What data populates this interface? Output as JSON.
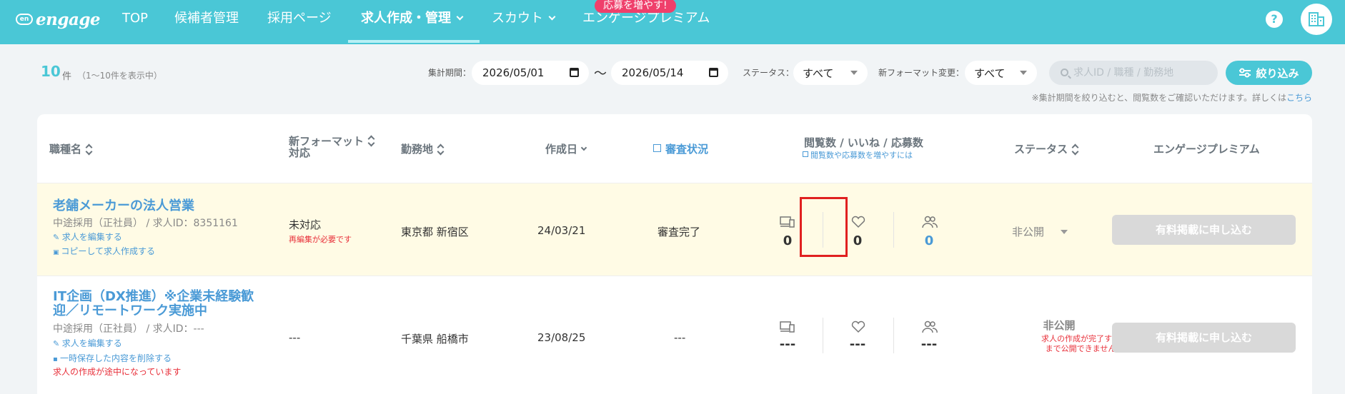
{
  "nav": {
    "logo_mark": "en",
    "logo_text": "engage",
    "items": [
      "TOP",
      "候補者管理",
      "採用ページ",
      "求人作成・管理",
      "スカウト",
      "エンゲージプレミアム"
    ],
    "promo_badge": "応募を増やす!"
  },
  "toolbar": {
    "count": "10",
    "count_unit": "件",
    "count_note": "（1〜10件を表示中）",
    "period_label": "集計期間：",
    "date_from": "2026/05/01",
    "date_sep": "〜",
    "date_to": "2026/05/14",
    "status_label": "ステータス：",
    "status_value": "すべて",
    "format_label": "新フォーマット変更：",
    "format_value": "すべて",
    "search_placeholder": "求人ID / 職種 / 勤務地",
    "filter_button": "絞り込み",
    "note": "※集計期間を絞り込むと、閲覧数をご確認いただけます。詳しくは",
    "note_link": "こちら"
  },
  "table": {
    "headers": {
      "job": "職種名",
      "format_line1": "新フォーマット",
      "format_line2": "対応",
      "location": "勤務地",
      "created": "作成日",
      "review": "審査状況",
      "stats": "閲覧数 / いいね / 応募数",
      "stats_sub": "閲覧数や応募数を増やすには",
      "status": "ステータス",
      "premium": "エンゲージプレミアム"
    },
    "rows": [
      {
        "title": "老舗メーカーの法人営業",
        "meta": "中途採用（正社員） / 求人ID：8351161",
        "link1": "求人を編集する",
        "link2": "コピーして求人作成する",
        "format": "未対応",
        "format_note": "再編集が必要です",
        "location": "東京都 新宿区",
        "created": "24/03/21",
        "review": "審査完了",
        "views": "0",
        "likes": "0",
        "applies": "0",
        "status": "非公開",
        "premium_button": "有料掲載に申し込む"
      },
      {
        "title_line1": "IT企画（DX推進）※企業未経験歓",
        "title_line2": "迎／リモートワーク実施中",
        "meta": "中途採用（正社員） / 求人ID：---",
        "link1": "求人を編集する",
        "link2": "一時保存した内容を削除する",
        "warning": "求人の作成が途中になっています",
        "format": "---",
        "location": "千葉県 船橋市",
        "created": "23/08/25",
        "review": "---",
        "views": "---",
        "likes": "---",
        "applies": "---",
        "status": "非公開",
        "status_note_line1": "求人の作成が完了する",
        "status_note_line2": "まで公開できません",
        "premium_button": "有料掲載に申し込む"
      }
    ]
  }
}
